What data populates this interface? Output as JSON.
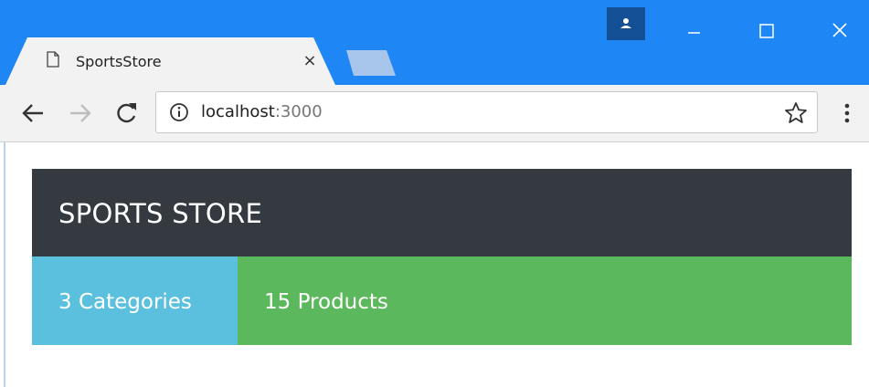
{
  "browser": {
    "tab_title": "SportsStore",
    "tab_close_glyph": "×",
    "url_host": "localhost",
    "url_port": ":3000",
    "icons": {
      "tab": "document-icon",
      "back": "back-arrow-icon",
      "forward": "forward-arrow-icon",
      "reload": "reload-icon",
      "info": "info-icon",
      "bookmark": "star-icon",
      "menu": "kebab-menu-icon",
      "profile": "person-icon",
      "minimize": "minimize-icon",
      "maximize": "maximize-icon",
      "close": "close-icon"
    },
    "colors": {
      "titlebar": "#1e86f5",
      "toolbar": "#f2f2f2",
      "profile": "#134f94"
    }
  },
  "page": {
    "brand": "SPORTS STORE",
    "categories_label": "3 Categories",
    "products_label": "15 Products",
    "colors": {
      "header": "#343a40",
      "categories": "#5bc0de",
      "products": "#5cb85c",
      "text": "#ffffff"
    }
  }
}
